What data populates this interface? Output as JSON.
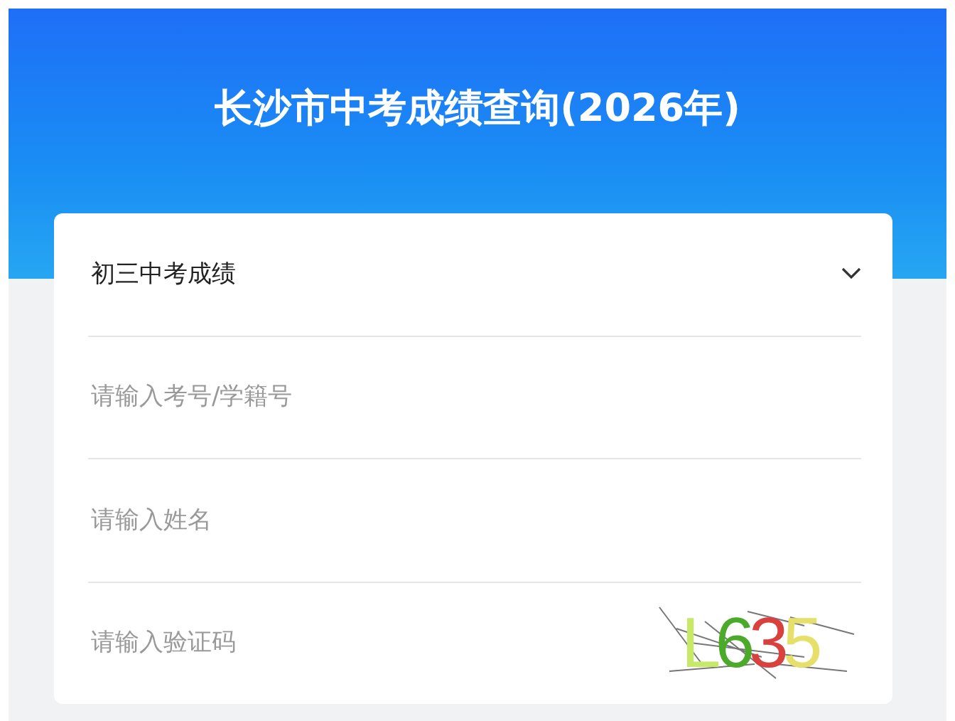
{
  "header": {
    "title": "长沙市中考成绩查询(2026年)"
  },
  "form": {
    "select": {
      "value": "初三中考成绩",
      "expanded": false
    },
    "fields": [
      {
        "kind": "text",
        "placeholder": "请输入考号/学籍号"
      },
      {
        "kind": "text",
        "placeholder": "请输入姓名"
      },
      {
        "kind": "captcha",
        "placeholder": "请输入验证码",
        "captcha": [
          {
            "char": "L",
            "color": "#c8e86a"
          },
          {
            "char": "6",
            "color": "#4caa2a"
          },
          {
            "char": "3",
            "color": "#d9413f"
          },
          {
            "char": "5",
            "color": "#e6e06a"
          }
        ]
      }
    ]
  }
}
